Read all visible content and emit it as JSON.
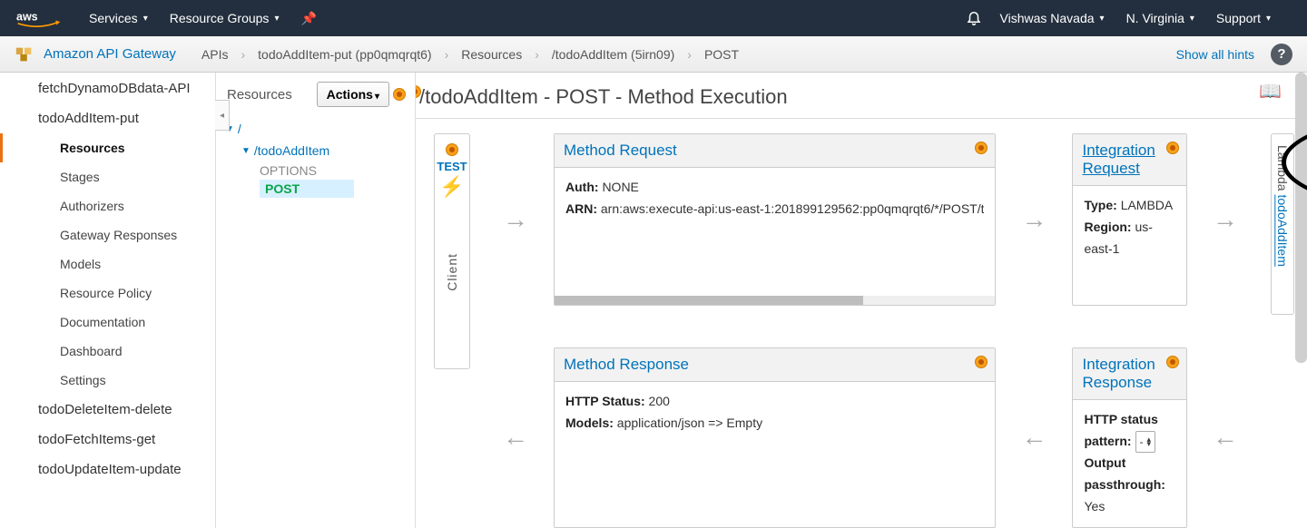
{
  "topnav": {
    "services": "Services",
    "resource_groups": "Resource Groups",
    "user": "Vishwas Navada",
    "region": "N. Virginia",
    "support": "Support"
  },
  "crumbs": {
    "service": "Amazon API Gateway",
    "items": [
      "APIs",
      "todoAddItem-put (pp0qmqrqt6)",
      "Resources",
      "/todoAddItem (5irn09)",
      "POST"
    ],
    "show_hints": "Show all hints"
  },
  "left_apis": {
    "truncated": "fetchDynamoDBdata-API",
    "current": "todoAddItem-put",
    "subs": [
      "Resources",
      "Stages",
      "Authorizers",
      "Gateway Responses",
      "Models",
      "Resource Policy",
      "Documentation",
      "Dashboard",
      "Settings"
    ],
    "others": [
      "todoDeleteItem-delete",
      "todoFetchItems-get",
      "todoUpdateItem-update"
    ]
  },
  "res_panel": {
    "title": "Resources",
    "actions": "Actions",
    "root": "/",
    "resource": "/todoAddItem",
    "methods": [
      "OPTIONS",
      "POST"
    ]
  },
  "content": {
    "title": "/todoAddItem - POST - Method Execution",
    "client": {
      "test": "TEST",
      "label": "Client"
    },
    "lambda": {
      "prefix": "Lambda ",
      "name": "todoAddItem"
    },
    "method_request": {
      "title": "Method Request",
      "auth_k": "Auth:",
      "auth_v": "NONE",
      "arn_k": "ARN:",
      "arn_v": "arn:aws:execute-api:us-east-1:201899129562:pp0qmqrqt6/*/POST/t"
    },
    "integration_request": {
      "title": "Integration Request",
      "type_k": "Type:",
      "type_v": "LAMBDA",
      "region_k": "Region:",
      "region_v": "us-east-1"
    },
    "method_response": {
      "title": "Method Response",
      "status_k": "HTTP Status:",
      "status_v": "200",
      "models_k": "Models:",
      "models_v": "application/json => Empty"
    },
    "integration_response": {
      "title": "Integration Response",
      "pattern_k": "HTTP status pattern:",
      "pattern_v": "-",
      "out_k": "Output passthrough:",
      "out_v": "Yes"
    }
  }
}
